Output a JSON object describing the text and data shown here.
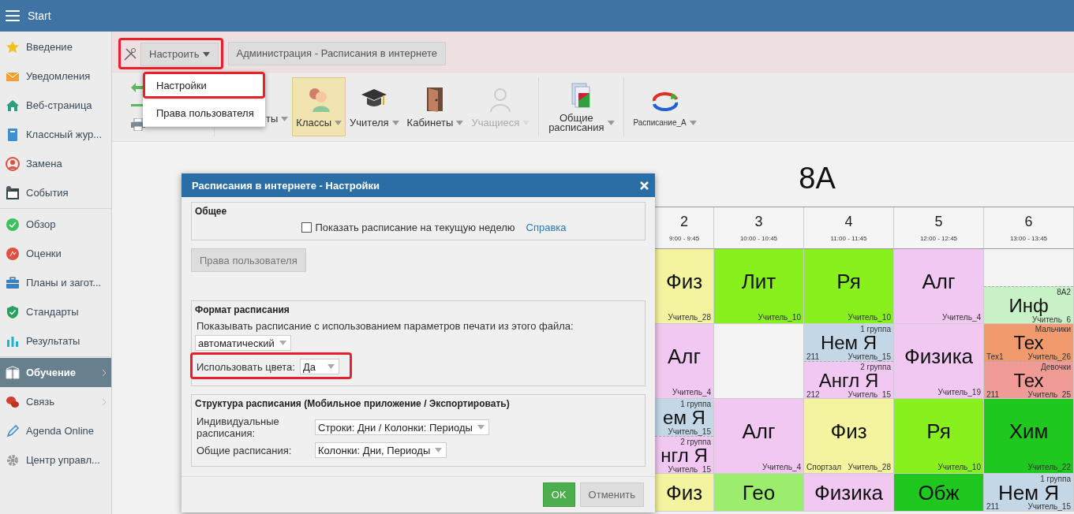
{
  "topbar": {
    "title": "Start"
  },
  "sidebar": {
    "groups": [
      [
        {
          "label": "Введение",
          "selected": false,
          "submenu": false
        },
        {
          "label": "Уведомления",
          "selected": false,
          "submenu": false
        },
        {
          "label": "Веб-страница",
          "selected": false,
          "submenu": false
        },
        {
          "label": "Классный жур...",
          "selected": false,
          "submenu": false
        },
        {
          "label": "Замена",
          "selected": false,
          "submenu": false
        },
        {
          "label": "События",
          "selected": false,
          "submenu": false
        }
      ],
      [
        {
          "label": "Обзор",
          "selected": false,
          "submenu": false
        },
        {
          "label": "Оценки",
          "selected": false,
          "submenu": false
        },
        {
          "label": "Планы и загот...",
          "selected": false,
          "submenu": false
        },
        {
          "label": "Стандарты",
          "selected": false,
          "submenu": false
        },
        {
          "label": "Результаты",
          "selected": false,
          "submenu": false
        }
      ],
      [
        {
          "label": "Обучение",
          "selected": true,
          "submenu": true
        },
        {
          "label": "Связь",
          "selected": false,
          "submenu": true
        },
        {
          "label": "Agenda Online",
          "selected": false,
          "submenu": false
        },
        {
          "label": "Центр управл...",
          "selected": false,
          "submenu": false
        }
      ]
    ]
  },
  "ribbon": {
    "configure_button": {
      "label": "Настроить",
      "highlighted": true
    },
    "admin_button": "Администрация - Расписания в интернете",
    "configure_menu": [
      {
        "label": "Настройки",
        "highlighted": true
      },
      {
        "label": "Права пользователя",
        "highlighted": false
      }
    ],
    "tools": [
      {
        "label": "ты",
        "selected": false,
        "disabled": false
      },
      {
        "label": "Классы",
        "selected": true,
        "disabled": false
      },
      {
        "label": "Учителя",
        "selected": false,
        "disabled": false
      },
      {
        "label": "Кабинеты",
        "selected": false,
        "disabled": false
      },
      {
        "label": "Учащиеся",
        "selected": false,
        "disabled": true
      },
      {
        "label": "Общие расписания",
        "selected": false,
        "disabled": false
      },
      {
        "label": "Расписание_А",
        "selected": false,
        "disabled": false
      }
    ]
  },
  "dialog": {
    "title": "Расписания в интернете - Настройки",
    "general": {
      "heading": "Общее",
      "checkbox": {
        "label": "Показать расписание на текущую неделю",
        "checked": false
      },
      "help_link": "Справка",
      "button": "Права пользователя"
    },
    "format": {
      "heading": "Формат расписания",
      "description": "Показывать расписание с использованием параметров печати из этого файла:",
      "file_select": "автоматический",
      "use_colors": {
        "label": "Использовать цвета:",
        "value": "Да",
        "highlighted": true
      }
    },
    "structure": {
      "heading": "Структура расписания (Мобильное приложение / Экспортировать)",
      "rows": [
        {
          "label": "Индивидуальные расписания:",
          "value": "Строки: Дни / Колонки: Периоды"
        },
        {
          "label": "Общие расписания:",
          "value": "Колонки: Дни, Периоды"
        }
      ]
    },
    "buttons": [
      {
        "label": "OK",
        "kind": "primary"
      },
      {
        "label": "Отменить",
        "kind": "secondary"
      }
    ]
  },
  "timetable": {
    "title": "8А",
    "periods": [
      {
        "number": "2",
        "time": "9:00 - 9:45"
      },
      {
        "number": "3",
        "time": "10:00 - 10:45"
      },
      {
        "number": "4",
        "time": "11:00 - 11:45"
      },
      {
        "number": "5",
        "time": "12:00 - 12:45"
      },
      {
        "number": "6",
        "time": "13:00 - 13:45"
      }
    ],
    "rows": [
      {
        "cells": [
          {
            "parts": [
              {
                "kind": "lesson",
                "subject": "Физ",
                "teacher": "Учитель_28",
                "color": "#f3f3a0"
              }
            ]
          },
          {
            "parts": [
              {
                "kind": "lesson",
                "subject": "Лит",
                "teacher": "Учитель_10",
                "color": "#88f01c"
              }
            ]
          },
          {
            "parts": [
              {
                "kind": "lesson",
                "subject": "Ря",
                "teacher": "Учитель_10",
                "color": "#88f01c"
              }
            ]
          },
          {
            "parts": [
              {
                "kind": "lesson",
                "subject": "Алг",
                "teacher": "Учитель_4",
                "color": "#f1c8f1"
              }
            ]
          },
          {
            "parts": [
              {
                "kind": "free"
              },
              {
                "kind": "lesson",
                "subject": "Инф",
                "group": "8А2",
                "teacher": "Учитель_6",
                "color": "#c8f1c8"
              }
            ]
          }
        ]
      },
      {
        "cells": [
          {
            "parts": [
              {
                "kind": "lesson",
                "subject": "Алг",
                "teacher": "Учитель_4",
                "color": "#f1c8f1"
              }
            ]
          },
          {
            "parts": [
              {
                "kind": "free"
              }
            ]
          },
          {
            "parts": [
              {
                "kind": "lesson",
                "subject": "Нем Я",
                "group": "1 группа",
                "room": "211",
                "teacher": "Учитель_15",
                "color": "#c3d7e6"
              },
              {
                "kind": "lesson",
                "subject": "Англ Я",
                "group": "2 группа",
                "room": "212",
                "teacher": "Учитель_15",
                "color": "#f1c8f1"
              }
            ]
          },
          {
            "parts": [
              {
                "kind": "lesson",
                "subject": "Физика",
                "teacher": "Учитель_19",
                "color": "#f1c8f1"
              }
            ]
          },
          {
            "parts": [
              {
                "kind": "lesson",
                "subject": "Тех",
                "group": "Мальчики",
                "room": "Тех1",
                "teacher": "Учитель_26",
                "color": "#f19a6e"
              },
              {
                "kind": "lesson",
                "subject": "Тех",
                "group": "Девочки",
                "room": "211",
                "teacher": "Учитель_25",
                "color": "#f19b96"
              }
            ]
          }
        ]
      },
      {
        "cells": [
          {
            "parts": [
              {
                "kind": "lesson",
                "subject": "ем Я",
                "group": "1 группа",
                "teacher": "Учитель_15",
                "color": "#c3d7e6"
              },
              {
                "kind": "lesson",
                "subject": "нгл Я",
                "group": "2 группа",
                "teacher": "Учитель_15",
                "color": "#f1c8f1"
              }
            ]
          },
          {
            "parts": [
              {
                "kind": "lesson",
                "subject": "Алг",
                "teacher": "Учитель_4",
                "color": "#f1c8f1"
              }
            ]
          },
          {
            "parts": [
              {
                "kind": "lesson",
                "subject": "Физ",
                "room": "Спортзал",
                "teacher": "Учитель_28",
                "color": "#f3f3a0"
              }
            ]
          },
          {
            "parts": [
              {
                "kind": "lesson",
                "subject": "Ря",
                "teacher": "Учитель_10",
                "color": "#88f01c"
              }
            ]
          },
          {
            "parts": [
              {
                "kind": "lesson",
                "subject": "Хим",
                "teacher": "Учитель_22",
                "color": "#1ec81e"
              }
            ]
          }
        ]
      },
      {
        "cells": [
          {
            "parts": [
              {
                "kind": "lesson",
                "subject": "Физ",
                "color": "#f3f3a0"
              }
            ]
          },
          {
            "parts": [
              {
                "kind": "lesson",
                "subject": "Гео",
                "color": "#9ced6e"
              }
            ]
          },
          {
            "parts": [
              {
                "kind": "lesson",
                "subject": "Физика",
                "color": "#f1c8f1"
              }
            ]
          },
          {
            "parts": [
              {
                "kind": "lesson",
                "subject": "Обж",
                "color": "#1ec81e"
              }
            ]
          },
          {
            "parts": [
              {
                "kind": "lesson",
                "subject": "Нем Я",
                "group": "1 группа",
                "room": "211",
                "teacher": "Учитель_15",
                "color": "#c3d7e6"
              }
            ]
          }
        ]
      }
    ]
  }
}
